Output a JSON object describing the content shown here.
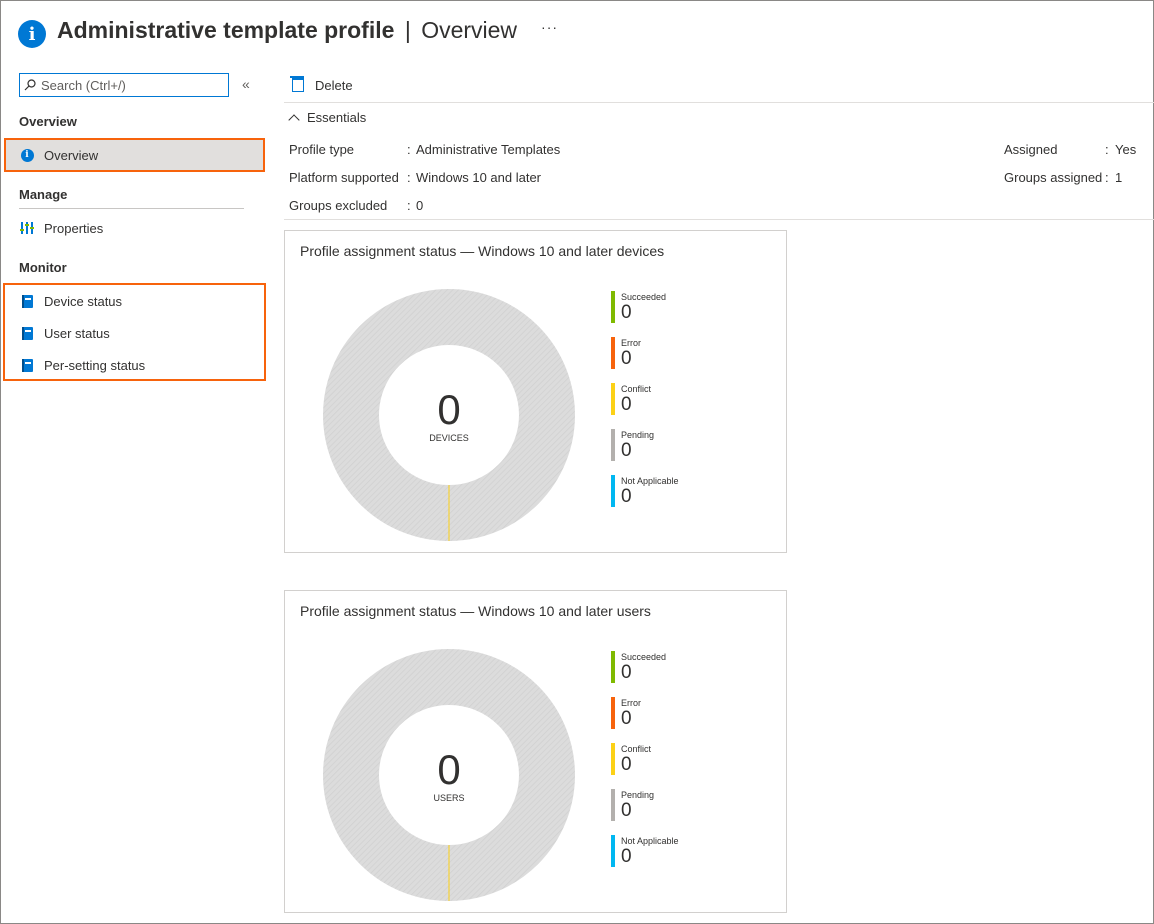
{
  "header": {
    "title": "Administrative template profile",
    "separator": "|",
    "subtitle": "Overview",
    "more": "···"
  },
  "sidebar": {
    "search_placeholder": "Search (Ctrl+/)",
    "collapse": "«",
    "sections": [
      {
        "label": "Overview",
        "items": [
          {
            "label": "Overview",
            "icon": "info-icon",
            "active": true
          }
        ]
      },
      {
        "label": "Manage",
        "items": [
          {
            "label": "Properties",
            "icon": "properties-icon"
          }
        ]
      },
      {
        "label": "Monitor",
        "items": [
          {
            "label": "Device status",
            "icon": "book-icon"
          },
          {
            "label": "User status",
            "icon": "book-icon"
          },
          {
            "label": "Per-setting status",
            "icon": "book-icon"
          }
        ]
      }
    ]
  },
  "toolbar": {
    "delete_label": "Delete"
  },
  "essentials": {
    "heading": "Essentials",
    "left": [
      {
        "key": "Profile type",
        "value": "Administrative Templates"
      },
      {
        "key": "Platform supported",
        "value": "Windows 10 and later"
      },
      {
        "key": "Groups excluded",
        "value": "0"
      }
    ],
    "right": [
      {
        "key": "Assigned",
        "value": "Yes"
      },
      {
        "key": "Groups assigned",
        "value": "1"
      }
    ]
  },
  "colors": {
    "accent": "#0078d4",
    "highlight": "#f7630c",
    "succeeded": "#7fba00",
    "error": "#f7630c",
    "conflict": "#fcd116",
    "pending": "#b3b0ad",
    "not_applicable": "#00b7f1"
  },
  "cards": [
    {
      "title": "Profile assignment status — Windows 10 and later devices",
      "center_value": "0",
      "center_label": "DEVICES",
      "legend": [
        {
          "name": "Succeeded",
          "value": "0"
        },
        {
          "name": "Error",
          "value": "0"
        },
        {
          "name": "Conflict",
          "value": "0"
        },
        {
          "name": "Pending",
          "value": "0"
        },
        {
          "name": "Not Applicable",
          "value": "0"
        }
      ]
    },
    {
      "title": "Profile assignment status — Windows 10 and later users",
      "center_value": "0",
      "center_label": "USERS",
      "legend": [
        {
          "name": "Succeeded",
          "value": "0"
        },
        {
          "name": "Error",
          "value": "0"
        },
        {
          "name": "Conflict",
          "value": "0"
        },
        {
          "name": "Pending",
          "value": "0"
        },
        {
          "name": "Not Applicable",
          "value": "0"
        }
      ]
    }
  ]
}
